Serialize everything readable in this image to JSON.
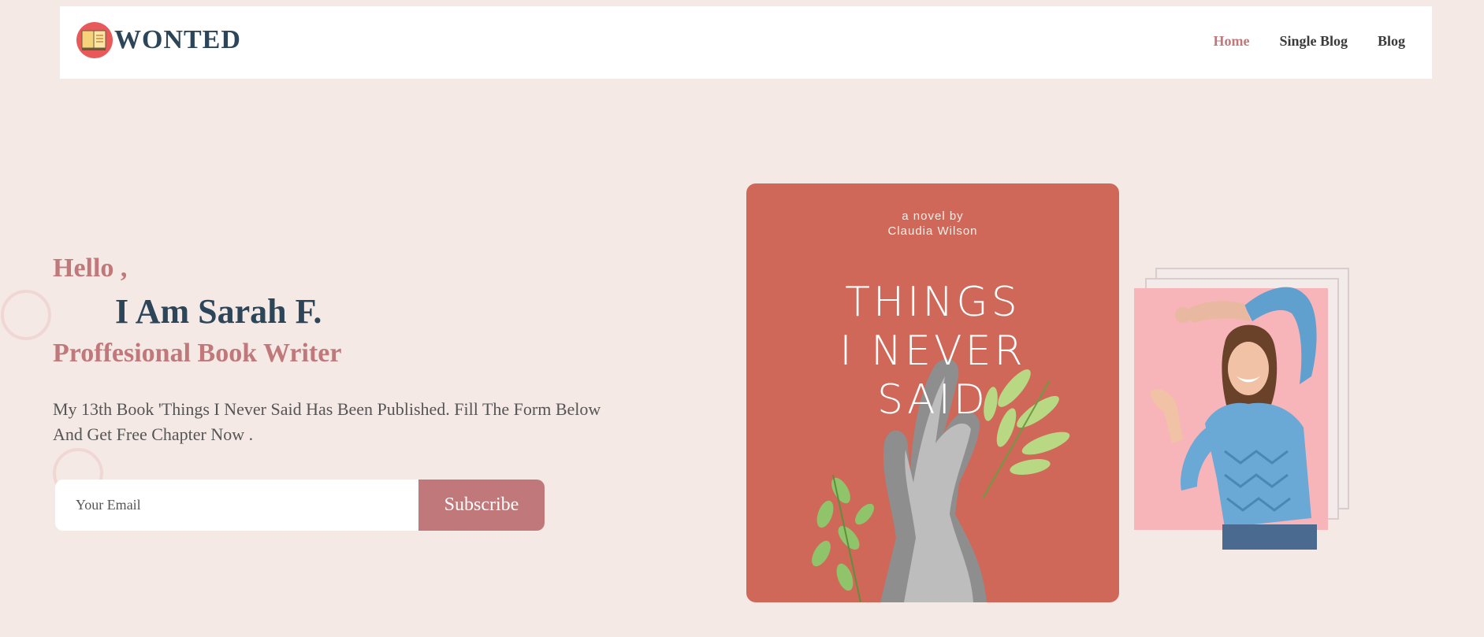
{
  "header": {
    "logo_text": "WONTED",
    "logo_icon": "book-icon",
    "nav": [
      {
        "label": "Home",
        "active": true
      },
      {
        "label": "Single Blog",
        "active": false
      },
      {
        "label": "Blog",
        "active": false
      }
    ]
  },
  "hero": {
    "greeting": "Hello ,",
    "name": "I Am Sarah F.",
    "role": "Proffesional Book Writer",
    "description": "My 13th Book 'Things I Never Said Has Been Published. Fill The Form Below And Get Free Chapter Now .",
    "email_placeholder": "Your Email",
    "subscribe_label": "Subscribe"
  },
  "book": {
    "byline_1": "a novel by",
    "byline_2": "Claudia Wilson",
    "title_line_1": "THINGS",
    "title_line_2": "I NEVER",
    "title_line_3": "SAID"
  },
  "colors": {
    "background": "#f4e9e5",
    "accent": "#c0787a",
    "heading": "#2c4559",
    "book_cover": "#cf6858",
    "portrait_bg": "#f7b5b9"
  }
}
